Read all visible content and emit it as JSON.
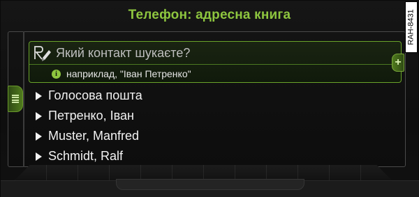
{
  "header": {
    "title": "Телефон: адресна книга"
  },
  "search": {
    "placeholder": "Який контакт шукаєте?",
    "hint": "наприклад, \"Іван Петренко\"",
    "handwriting_icon": "handwriting-pen-icon",
    "info_icon": "info-icon",
    "info_glyph": "i"
  },
  "side_tabs": {
    "left_icon": "menu-lines-icon",
    "right_icon": "plus-icon",
    "right_glyph": "+"
  },
  "contacts": [
    {
      "label": "Голосова пошта"
    },
    {
      "label": "Петренко, Іван"
    },
    {
      "label": "Muster, Manfred"
    },
    {
      "label": "Schmidt, Ralf"
    }
  ],
  "figure_ref": "RAH-8431",
  "colors": {
    "accent": "#8ec63f",
    "background": "#121212",
    "text": "#f2f2f2",
    "frame_green": "#6aa42a"
  }
}
